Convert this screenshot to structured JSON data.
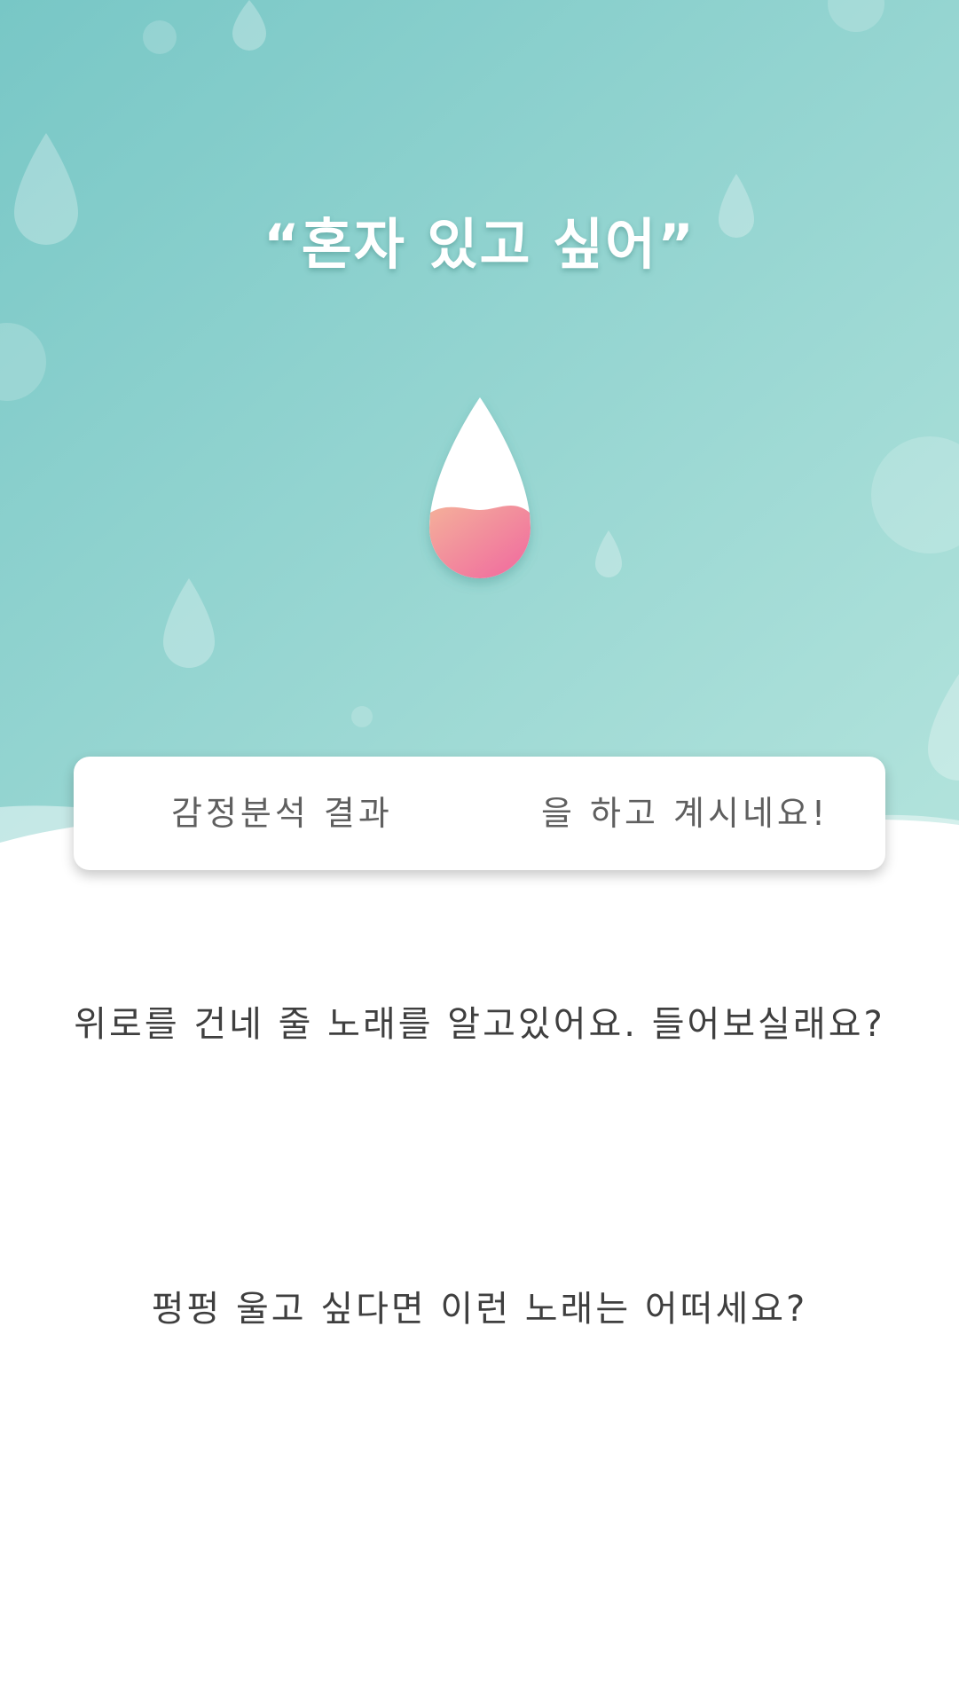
{
  "header": {
    "emotion_quote": "“혼자 있고 싶어”"
  },
  "emotion_icon": {
    "name": "water-drop-icon",
    "fill_colors": [
      "#f3a99a",
      "#f06e9e"
    ]
  },
  "result_card": {
    "left_label": "감정분석 결과",
    "right_label": "을 하고 계시네요!"
  },
  "recommendations": [
    {
      "prompt": "위로를 건네 줄 노래를 알고있어요. 들어보실래요?"
    },
    {
      "prompt": "펑펑 울고 싶다면 이런 노래는 어떠세요?"
    }
  ],
  "theme": {
    "background_top": "#7ecaca",
    "background_bottom": "#ade0d9",
    "text_color": "#3f3f3f"
  }
}
